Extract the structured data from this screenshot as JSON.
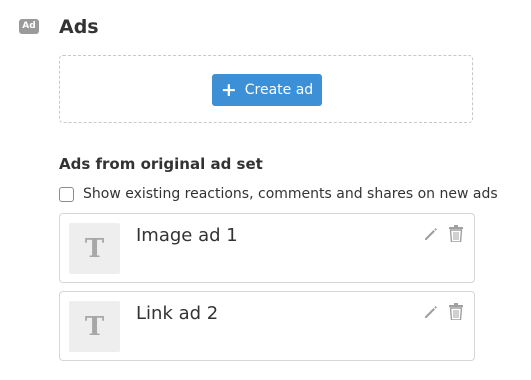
{
  "section": {
    "badge_text": "Ad",
    "title": "Ads",
    "badge_icon": "ad-badge-icon"
  },
  "create": {
    "button_label": "Create ad",
    "button_icon": "plus-icon",
    "button_color": "#3d8fd6"
  },
  "original": {
    "title": "Ads from original ad set",
    "checkbox_label": "Show existing reactions, comments and shares on new ads",
    "checkbox_checked": false
  },
  "ads": [
    {
      "thumb_letter": "T",
      "name": "Image ad 1",
      "icons": [
        "pencil-icon",
        "trash-icon"
      ]
    },
    {
      "thumb_letter": "T",
      "name": "Link ad 2",
      "icons": [
        "pencil-icon",
        "trash-icon"
      ]
    }
  ]
}
